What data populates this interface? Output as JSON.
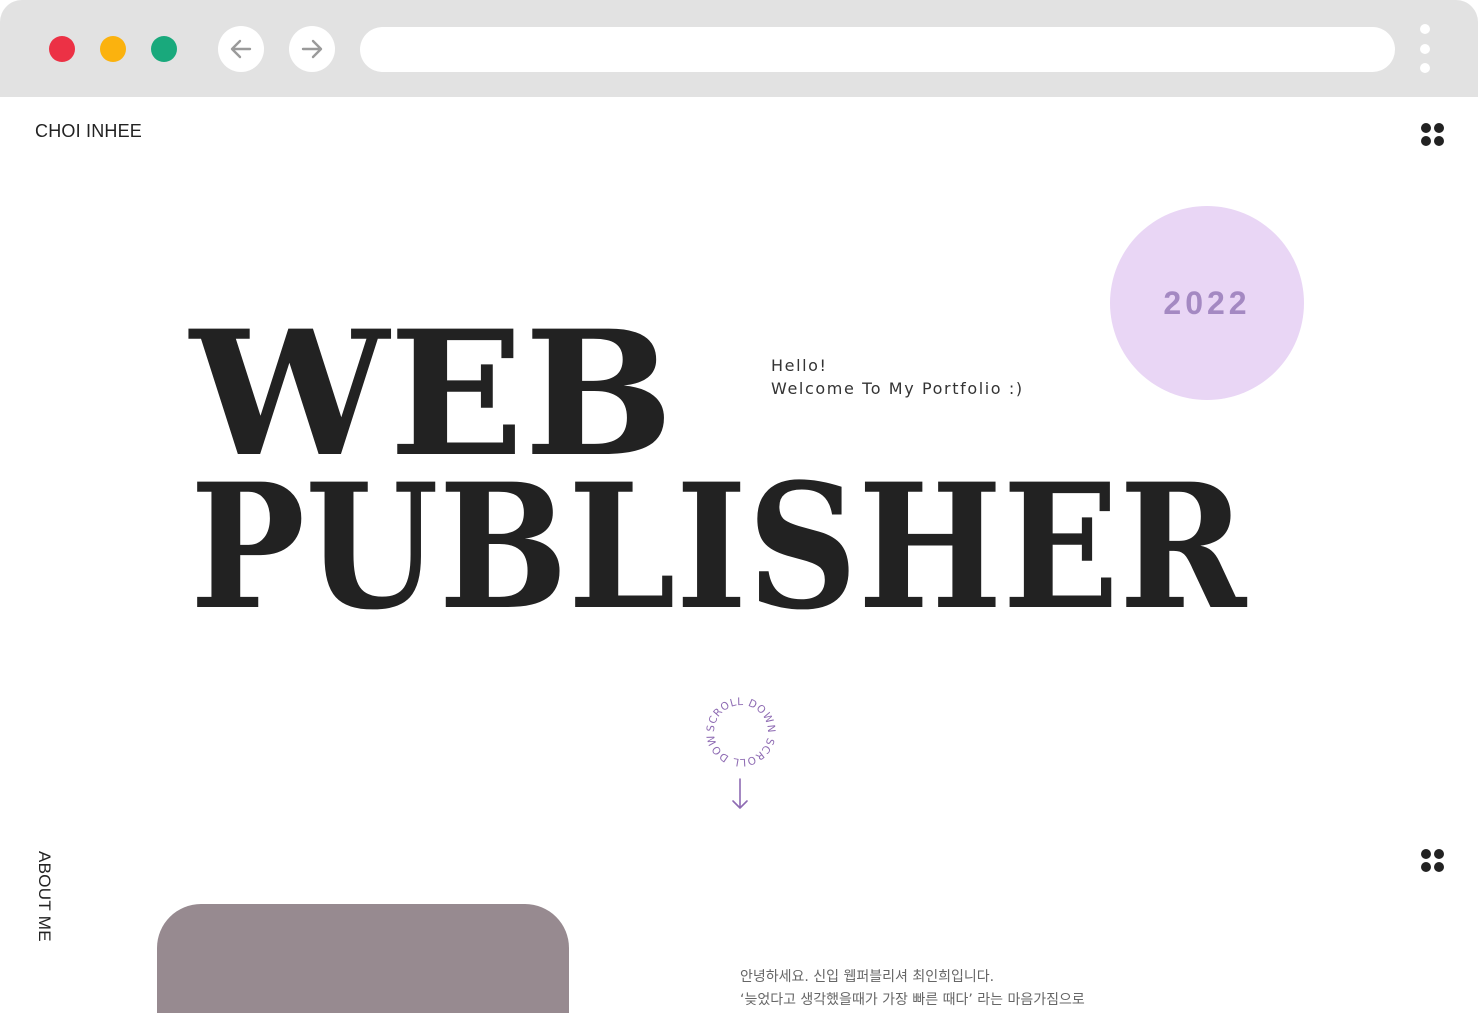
{
  "browser": {
    "back_icon": "arrow-left-icon",
    "forward_icon": "arrow-right-icon",
    "menu_icon": "kebab-menu-icon",
    "url": ""
  },
  "header": {
    "brand": "CHOI INHEE",
    "menu_icon": "grid-dots-icon"
  },
  "hero": {
    "year": "2022",
    "greeting_line1": "Hello!",
    "greeting_line2": "Welcome To My Portfolio :)",
    "title_line1": "WEB",
    "title_line2": "PUBLISHER",
    "scroll_text": "SCROLL DOWN SCROLL DOWN ",
    "scroll_icon": "arrow-down-icon"
  },
  "about": {
    "section_label": "ABOUT ME",
    "menu_icon": "grid-dots-icon",
    "intro_line1": "안녕하세요. 신입 웹퍼블리셔 최인희입니다.",
    "intro_line2": "‘늦었다고 생각했을때가 가장 빠른 때다’ 라는 마음가짐으로"
  },
  "colors": {
    "chrome": "#e2e2e2",
    "close": "#ec3145",
    "minimize": "#fbb20e",
    "maximize": "#19a97c",
    "accent_circle": "#e9d6f5",
    "accent_text": "#a489c2",
    "photo": "#978a90"
  }
}
